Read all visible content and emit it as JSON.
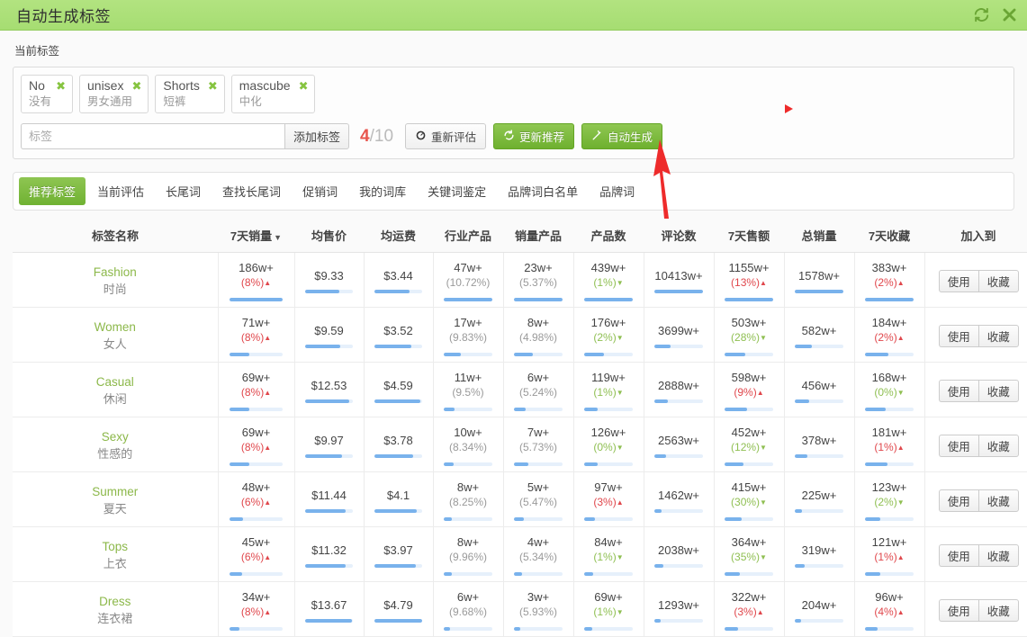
{
  "window": {
    "title": "自动生成标签",
    "refresh_icon": "refresh-icon",
    "close_icon": "close-icon",
    "header_color": "#a9de78"
  },
  "current_tags": {
    "section_label": "当前标签",
    "chips": [
      {
        "name": "No",
        "sub": "没有",
        "remove": "✖"
      },
      {
        "name": "unisex",
        "sub": "男女通用",
        "remove": "✖"
      },
      {
        "name": "Shorts",
        "sub": "短裤",
        "remove": "✖"
      },
      {
        "name": "mascube",
        "sub": "中化",
        "remove": "✖"
      }
    ],
    "input": {
      "value": "",
      "placeholder": "标签"
    },
    "add_label": "添加标签",
    "counter": {
      "current": "4",
      "separator": "/",
      "max": "10",
      "current_color": "#e8554d"
    },
    "buttons": [
      {
        "label": "重新评估",
        "icon": "gauge-icon",
        "style": "grey"
      },
      {
        "label": "更新推荐",
        "icon": "refresh-icon",
        "style": "green"
      },
      {
        "label": "自动生成",
        "icon": "wand-icon",
        "style": "green"
      }
    ]
  },
  "tabs": [
    {
      "label": "推荐标签",
      "active": true
    },
    {
      "label": "当前评估",
      "active": false
    },
    {
      "label": "长尾词",
      "active": false
    },
    {
      "label": "查找长尾词",
      "active": false
    },
    {
      "label": "促销词",
      "active": false
    },
    {
      "label": "我的词库",
      "active": false
    },
    {
      "label": "关键词鉴定",
      "active": false
    },
    {
      "label": "品牌词白名单",
      "active": false
    },
    {
      "label": "品牌词",
      "active": false
    }
  ],
  "table": {
    "columns": [
      {
        "label": "标签名称",
        "sorted": false
      },
      {
        "label": "7天销量",
        "sorted": true,
        "caret": "▼"
      },
      {
        "label": "均售价",
        "sorted": false
      },
      {
        "label": "均运费",
        "sorted": false
      },
      {
        "label": "行业产品",
        "sorted": false
      },
      {
        "label": "销量产品",
        "sorted": false
      },
      {
        "label": "产品数",
        "sorted": false
      },
      {
        "label": "评论数",
        "sorted": false
      },
      {
        "label": "7天售额",
        "sorted": false
      },
      {
        "label": "总销量",
        "sorted": false
      },
      {
        "label": "7天收藏",
        "sorted": false
      },
      {
        "label": "加入到",
        "sorted": false
      }
    ],
    "row_actions": {
      "use": "使用",
      "favorite": "收藏"
    },
    "rows": [
      {
        "tag_en": "Fashion",
        "tag_cn": "时尚",
        "sales_7d": {
          "value": "186w+",
          "pct": "(8%)",
          "dir": "up",
          "bar": 100
        },
        "avg_price": {
          "value": "$9.33",
          "bar": 72
        },
        "avg_shipping": {
          "value": "$3.44",
          "bar": 74
        },
        "industry_products": {
          "value": "47w+",
          "pct": "(10.72%)",
          "dir": "plain",
          "bar": 100
        },
        "sales_products": {
          "value": "23w+",
          "pct": "(5.37%)",
          "dir": "plain",
          "bar": 100
        },
        "product_count": {
          "value": "439w+",
          "pct": "(1%)",
          "dir": "down",
          "bar": 100
        },
        "review_count": {
          "value": "10413w+",
          "bar": 100
        },
        "revenue_7d": {
          "value": "1155w+",
          "pct": "(13%)",
          "dir": "up",
          "bar": 100
        },
        "total_sales": {
          "value": "1578w+",
          "bar": 100
        },
        "favorites_7d": {
          "value": "383w+",
          "pct": "(2%)",
          "dir": "up",
          "bar": 100
        }
      },
      {
        "tag_en": "Women",
        "tag_cn": "女人",
        "sales_7d": {
          "value": "71w+",
          "pct": "(8%)",
          "dir": "up",
          "bar": 38
        },
        "avg_price": {
          "value": "$9.59",
          "bar": 74
        },
        "avg_shipping": {
          "value": "$3.52",
          "bar": 77
        },
        "industry_products": {
          "value": "17w+",
          "pct": "(9.83%)",
          "dir": "plain",
          "bar": 36
        },
        "sales_products": {
          "value": "8w+",
          "pct": "(4.98%)",
          "dir": "plain",
          "bar": 38
        },
        "product_count": {
          "value": "176w+",
          "pct": "(2%)",
          "dir": "down",
          "bar": 40
        },
        "review_count": {
          "value": "3699w+",
          "bar": 33
        },
        "revenue_7d": {
          "value": "503w+",
          "pct": "(28%)",
          "dir": "down",
          "bar": 42
        },
        "total_sales": {
          "value": "582w+",
          "bar": 36
        },
        "favorites_7d": {
          "value": "184w+",
          "pct": "(2%)",
          "dir": "up",
          "bar": 48
        }
      },
      {
        "tag_en": "Casual",
        "tag_cn": "休闲",
        "sales_7d": {
          "value": "69w+",
          "pct": "(8%)",
          "dir": "up",
          "bar": 37
        },
        "avg_price": {
          "value": "$12.53",
          "bar": 93
        },
        "avg_shipping": {
          "value": "$4.59",
          "bar": 97
        },
        "industry_products": {
          "value": "11w+",
          "pct": "(9.5%)",
          "dir": "plain",
          "bar": 23
        },
        "sales_products": {
          "value": "6w+",
          "pct": "(5.24%)",
          "dir": "plain",
          "bar": 24
        },
        "product_count": {
          "value": "119w+",
          "pct": "(1%)",
          "dir": "down",
          "bar": 27
        },
        "review_count": {
          "value": "2888w+",
          "bar": 27
        },
        "revenue_7d": {
          "value": "598w+",
          "pct": "(9%)",
          "dir": "up",
          "bar": 46
        },
        "total_sales": {
          "value": "456w+",
          "bar": 29
        },
        "favorites_7d": {
          "value": "168w+",
          "pct": "(0%)",
          "dir": "down",
          "bar": 43
        }
      },
      {
        "tag_en": "Sexy",
        "tag_cn": "性感的",
        "sales_7d": {
          "value": "69w+",
          "pct": "(8%)",
          "dir": "up",
          "bar": 37
        },
        "avg_price": {
          "value": "$9.97",
          "bar": 77
        },
        "avg_shipping": {
          "value": "$3.78",
          "bar": 82
        },
        "industry_products": {
          "value": "10w+",
          "pct": "(8.34%)",
          "dir": "plain",
          "bar": 21
        },
        "sales_products": {
          "value": "7w+",
          "pct": "(5.73%)",
          "dir": "plain",
          "bar": 29
        },
        "product_count": {
          "value": "126w+",
          "pct": "(0%)",
          "dir": "down",
          "bar": 28
        },
        "review_count": {
          "value": "2563w+",
          "bar": 24
        },
        "revenue_7d": {
          "value": "452w+",
          "pct": "(12%)",
          "dir": "down",
          "bar": 38
        },
        "total_sales": {
          "value": "378w+",
          "bar": 25
        },
        "favorites_7d": {
          "value": "181w+",
          "pct": "(1%)",
          "dir": "up",
          "bar": 47
        }
      },
      {
        "tag_en": "Summer",
        "tag_cn": "夏天",
        "sales_7d": {
          "value": "48w+",
          "pct": "(6%)",
          "dir": "up",
          "bar": 26
        },
        "avg_price": {
          "value": "$11.44",
          "bar": 85
        },
        "avg_shipping": {
          "value": "$4.1",
          "bar": 89
        },
        "industry_products": {
          "value": "8w+",
          "pct": "(8.25%)",
          "dir": "plain",
          "bar": 17
        },
        "sales_products": {
          "value": "5w+",
          "pct": "(5.47%)",
          "dir": "plain",
          "bar": 21
        },
        "product_count": {
          "value": "97w+",
          "pct": "(3%)",
          "dir": "up",
          "bar": 22
        },
        "review_count": {
          "value": "1462w+",
          "bar": 14
        },
        "revenue_7d": {
          "value": "415w+",
          "pct": "(30%)",
          "dir": "down",
          "bar": 35
        },
        "total_sales": {
          "value": "225w+",
          "bar": 15
        },
        "favorites_7d": {
          "value": "123w+",
          "pct": "(2%)",
          "dir": "down",
          "bar": 32
        }
      },
      {
        "tag_en": "Tops",
        "tag_cn": "上衣",
        "sales_7d": {
          "value": "45w+",
          "pct": "(6%)",
          "dir": "up",
          "bar": 24
        },
        "avg_price": {
          "value": "$11.32",
          "bar": 84
        },
        "avg_shipping": {
          "value": "$3.97",
          "bar": 86
        },
        "industry_products": {
          "value": "8w+",
          "pct": "(9.96%)",
          "dir": "plain",
          "bar": 17
        },
        "sales_products": {
          "value": "4w+",
          "pct": "(5.34%)",
          "dir": "plain",
          "bar": 17
        },
        "product_count": {
          "value": "84w+",
          "pct": "(1%)",
          "dir": "down",
          "bar": 19
        },
        "review_count": {
          "value": "2038w+",
          "bar": 19
        },
        "revenue_7d": {
          "value": "364w+",
          "pct": "(35%)",
          "dir": "down",
          "bar": 31
        },
        "total_sales": {
          "value": "319w+",
          "bar": 21
        },
        "favorites_7d": {
          "value": "121w+",
          "pct": "(1%)",
          "dir": "up",
          "bar": 31
        }
      },
      {
        "tag_en": "Dress",
        "tag_cn": "连衣裙",
        "sales_7d": {
          "value": "34w+",
          "pct": "(8%)",
          "dir": "up",
          "bar": 18
        },
        "avg_price": {
          "value": "$13.67",
          "bar": 99
        },
        "avg_shipping": {
          "value": "$4.79",
          "bar": 100
        },
        "industry_products": {
          "value": "6w+",
          "pct": "(9.68%)",
          "dir": "plain",
          "bar": 13
        },
        "sales_products": {
          "value": "3w+",
          "pct": "(5.93%)",
          "dir": "plain",
          "bar": 13
        },
        "product_count": {
          "value": "69w+",
          "pct": "(1%)",
          "dir": "down",
          "bar": 16
        },
        "review_count": {
          "value": "1293w+",
          "bar": 12
        },
        "revenue_7d": {
          "value": "322w+",
          "pct": "(3%)",
          "dir": "up",
          "bar": 27
        },
        "total_sales": {
          "value": "204w+",
          "bar": 13
        },
        "favorites_7d": {
          "value": "96w+",
          "pct": "(4%)",
          "dir": "up",
          "bar": 25
        }
      }
    ]
  },
  "annotations": {
    "arrow_color": "#ee2b2b",
    "marker_color": "#ee2b2b"
  }
}
